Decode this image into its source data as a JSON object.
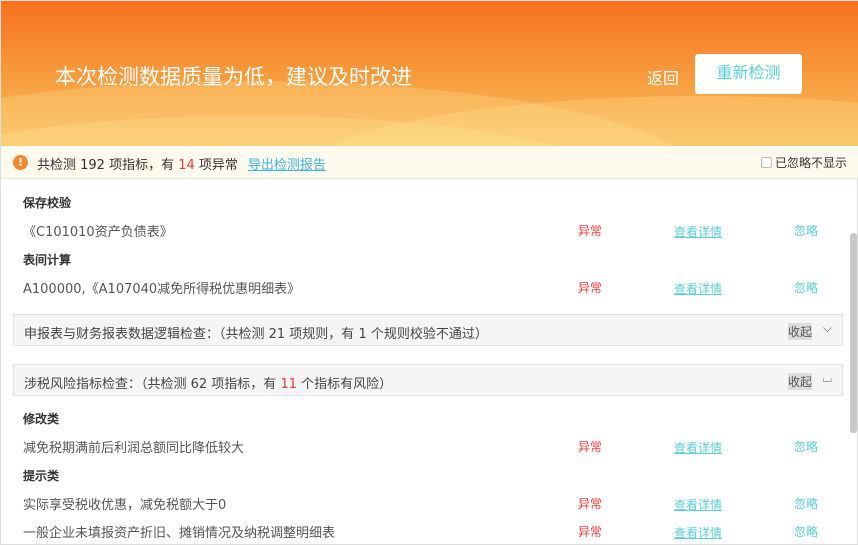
{
  "header": {
    "title": "本次检测数据质量为低，建议及时改进",
    "back_label": "返回",
    "recheck_label": "重新检测"
  },
  "summary": {
    "prefix": "共检测 192 项指标，有 ",
    "abnormal_count": "14",
    "suffix": " 项异常",
    "export_link": "导出检测报告",
    "hide_ignored": "已忽略不显示",
    "hide_ignored_checked": false
  },
  "row_actions": {
    "status": "异常",
    "detail": "查看详情",
    "ignore": "忽略"
  },
  "groups1": [
    {
      "heading": "保存校验",
      "rows": [
        "《C101010资产负债表》"
      ]
    },
    {
      "heading": "表间计算",
      "rows": [
        "A100000,《A107040减免所得税优惠明细表》"
      ]
    }
  ],
  "panel1": {
    "title": "申报表与财务报表数据逻辑检查：（共检测 21 项规则，有 1 个规则校验不通过）",
    "collapse": "收起",
    "chevron": "chevron-down"
  },
  "panel2": {
    "title_a": "涉税风险指标检查：（共检测 62 项指标，有 ",
    "risk_count": "11",
    "title_b": " 个指标有风险）",
    "collapse": "收起",
    "chevron": "chevron-up"
  },
  "groups2": [
    {
      "heading": "修改类",
      "rows": [
        "减免税期满前后利润总额同比降低较大"
      ]
    },
    {
      "heading": "提示类",
      "rows": [
        "实际享受税收优惠，减免税额大于0",
        "一般企业未填报资产折旧、摊销情况及纳税调整明细表"
      ]
    }
  ],
  "colors": {
    "accent": "#5bcfd6",
    "danger": "#f03c3c",
    "header_orange": "#f7711f"
  }
}
